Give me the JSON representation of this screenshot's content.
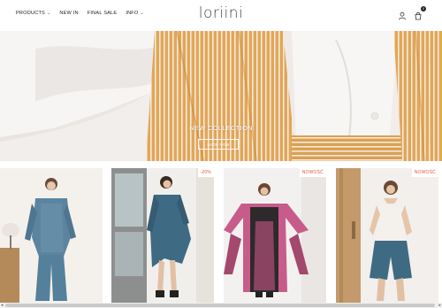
{
  "header": {
    "logo": "loriini",
    "nav": [
      {
        "label": "PRODUCTS",
        "has_dropdown": true
      },
      {
        "label": "NEW IN",
        "has_dropdown": false
      },
      {
        "label": "FINAL SALE",
        "has_dropdown": false
      },
      {
        "label": "INFO",
        "has_dropdown": true
      }
    ],
    "chevron": "⌄",
    "icons": [
      "user-icon",
      "cart-icon"
    ],
    "cart_count": "0"
  },
  "hero": {
    "title": "NEW COLLECTION",
    "button_label": "SHOP NOW"
  },
  "products": [
    {
      "badge": ""
    },
    {
      "badge": "-20%"
    },
    {
      "badge": "NOWOŚĆ"
    },
    {
      "badge": "NOWOŚĆ"
    }
  ],
  "colors": {
    "badge_text": "#e05a3c",
    "stripe_orange": "#d9963d",
    "print_blue": "#3f6a83",
    "print_pink": "#c75c8a"
  }
}
